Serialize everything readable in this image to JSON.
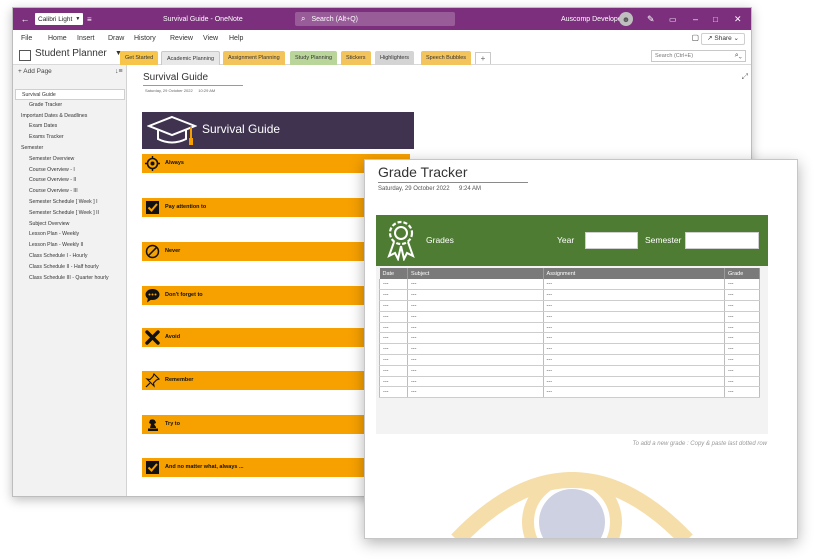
{
  "window": {
    "font_name": "Calibri Light",
    "title": "Survival Guide  -  OneNote",
    "search_placeholder": "Search (Alt+Q)",
    "user_name": "Auscomp Developer",
    "accent_color": "#7b2f7d"
  },
  "menu": {
    "items": [
      "File",
      "Home",
      "Insert",
      "Draw",
      "History",
      "Review",
      "View",
      "Help"
    ],
    "share_label": "Share"
  },
  "notebook": {
    "name": "Student Planner",
    "sections": [
      {
        "label": "Get Started",
        "color": "#f6c54a"
      },
      {
        "label": "Academic Planning",
        "color": "#e8e8e8",
        "active": true
      },
      {
        "label": "Assignment Planning",
        "color": "#f3c35c"
      },
      {
        "label": "Study Planning",
        "color": "#b9d59a"
      },
      {
        "label": "Stickers",
        "color": "#f3c35c"
      },
      {
        "label": "Highlighters",
        "color": "#d4d4d4"
      },
      {
        "label": "Speech Bubbles",
        "color": "#f3c35c"
      }
    ],
    "search_placeholder": "Search (Ctrl+E)"
  },
  "sidebar": {
    "add_page_label": "Add Page",
    "pages": [
      {
        "label": "Survival Guide",
        "indent": 0,
        "active": true
      },
      {
        "label": "Grade Tracker",
        "indent": 1
      },
      {
        "label": "Important Dates & Deadlines",
        "indent": 0
      },
      {
        "label": "Exam Dates",
        "indent": 1
      },
      {
        "label": "Exams Tracker",
        "indent": 1
      },
      {
        "label": "Semester",
        "indent": 0
      },
      {
        "label": "Semester Overview",
        "indent": 1
      },
      {
        "label": "Course Overview - I",
        "indent": 1
      },
      {
        "label": "Course Overview - II",
        "indent": 1
      },
      {
        "label": "Course Overview - III",
        "indent": 1
      },
      {
        "label": "Semester Schedule [ Week ] I",
        "indent": 1
      },
      {
        "label": "Semester Schedule [ Week ] II",
        "indent": 1
      },
      {
        "label": "Subject Overview",
        "indent": 1
      },
      {
        "label": "Lesson Plan - Weekly",
        "indent": 1
      },
      {
        "label": "Lesson Plan - Weekly II",
        "indent": 1
      },
      {
        "label": "Class Schedule I - Hourly",
        "indent": 1
      },
      {
        "label": "Class Schedule II - Half hourly",
        "indent": 1
      },
      {
        "label": "Class Schedule III - Quarter hourly",
        "indent": 1
      }
    ]
  },
  "page": {
    "title": "Survival Guide",
    "date": "Saturday, 29 October 2022",
    "time": "10:29 AM",
    "banner_title": "Survival Guide",
    "banner_color": "#3f3350",
    "band_color": "#f7a100",
    "bands": [
      {
        "label": "Always",
        "icon": "target-icon"
      },
      {
        "label": "Pay attention to",
        "icon": "checkbox-icon"
      },
      {
        "label": "Never",
        "icon": "prohibited-icon"
      },
      {
        "label": "Don't forget to",
        "icon": "speech-bubble-icon"
      },
      {
        "label": "Avoid",
        "icon": "cross-icon"
      },
      {
        "label": "Remember",
        "icon": "pushpin-icon"
      },
      {
        "label": "Try to",
        "icon": "chess-piece-icon"
      },
      {
        "label": "And no matter what, always ...",
        "icon": "checkbox-icon"
      }
    ]
  },
  "grade_tracker": {
    "title": "Grade Tracker",
    "date": "Saturday, 29 October 2022",
    "time": "9:24 AM",
    "header_color": "#4f7c33",
    "grades_label": "Grades",
    "year_label": "Year",
    "semester_label": "Semester",
    "columns": [
      "Date",
      "Subject",
      "Assignment",
      "Grade"
    ],
    "placeholder": "---",
    "row_count": 11,
    "hint": "To add a new grade : Copy & paste last dotted row"
  }
}
